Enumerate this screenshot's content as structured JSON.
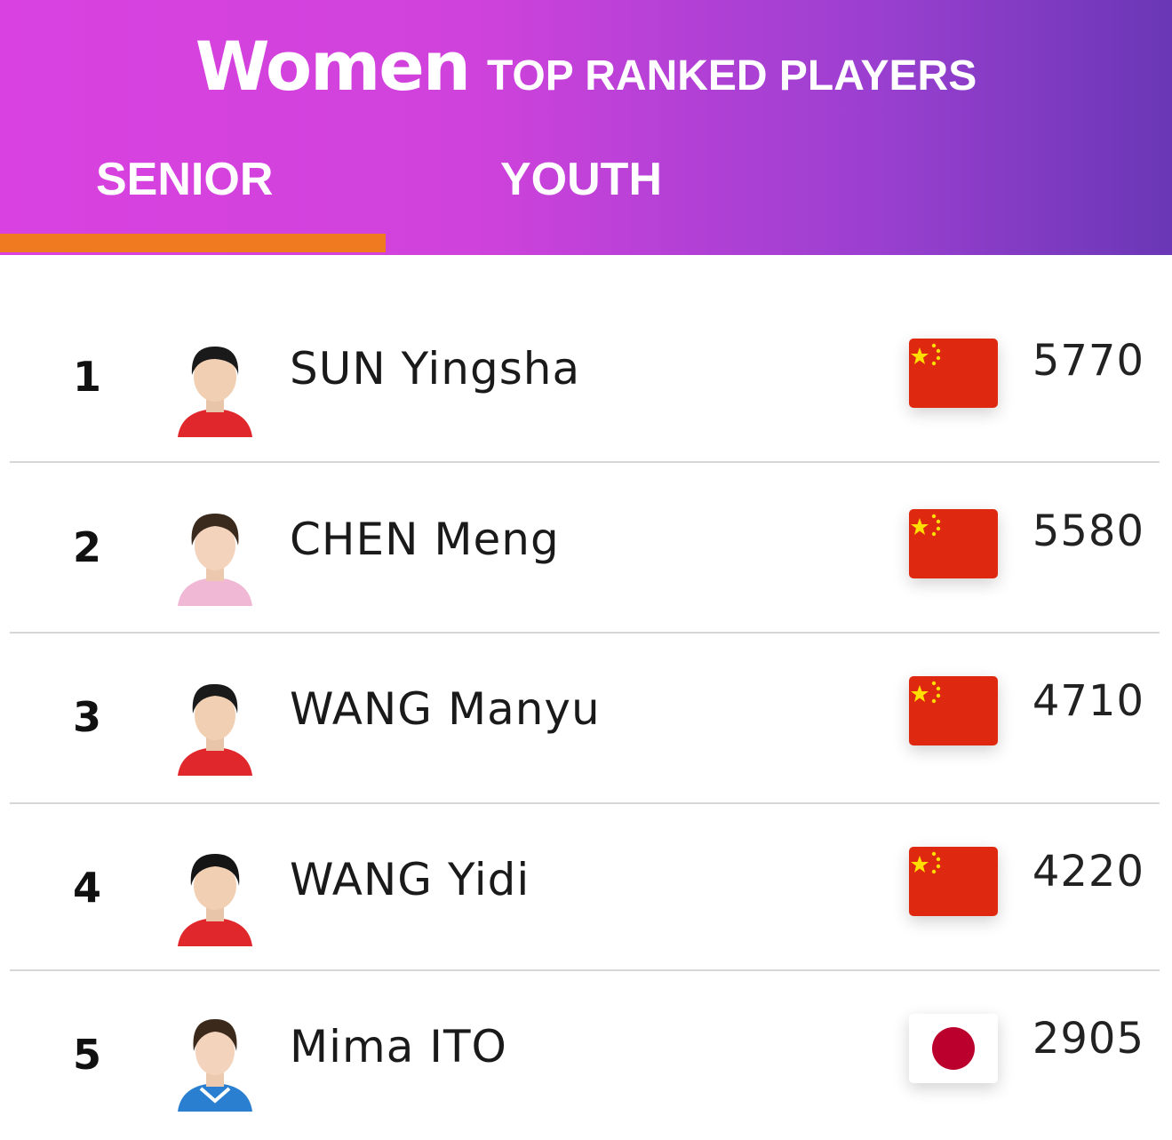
{
  "header": {
    "title": "Women",
    "subtitle": "TOP RANKED PLAYERS",
    "tabs": [
      {
        "label": "SENIOR",
        "active": true
      },
      {
        "label": "YOUTH",
        "active": false
      }
    ],
    "accent_color": "#f07a1f"
  },
  "players": [
    {
      "rank": "1",
      "name": "SUN Yingsha",
      "country_flag": "china-flag",
      "points": "5770",
      "shirt_color": "#e0272b"
    },
    {
      "rank": "2",
      "name": "CHEN Meng",
      "country_flag": "china-flag",
      "points": "5580",
      "shirt_color": "#f0b8d4"
    },
    {
      "rank": "3",
      "name": "WANG Manyu",
      "country_flag": "china-flag",
      "points": "4710",
      "shirt_color": "#e0272b"
    },
    {
      "rank": "4",
      "name": "WANG Yidi",
      "country_flag": "china-flag",
      "points": "4220",
      "shirt_color": "#e0272b"
    },
    {
      "rank": "5",
      "name": "Mima ITO",
      "country_flag": "japan-flag",
      "points": "2905",
      "shirt_color": "#2a7fd0"
    }
  ]
}
